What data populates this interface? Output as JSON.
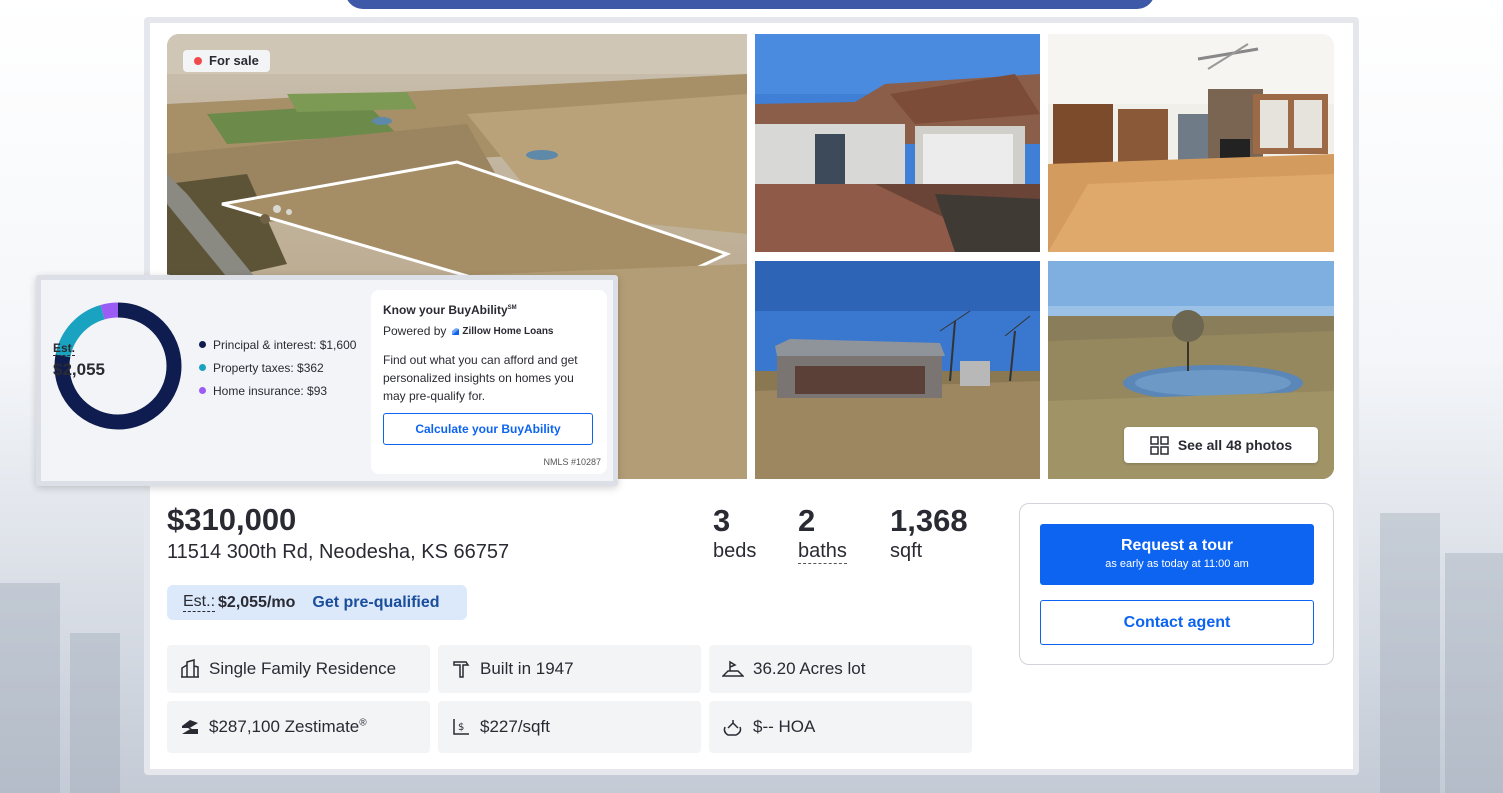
{
  "listing": {
    "status_badge": "For sale",
    "see_all_photos": "See all 48 photos",
    "price": "$310,000",
    "address": "11514 300th Rd, Neodesha, KS 66757",
    "beds_num": "3",
    "beds_label": "beds",
    "baths_num": "2",
    "baths_label": "baths",
    "sqft_num": "1,368",
    "sqft_label": "sqft"
  },
  "estimate_pill": {
    "est_label": "Est.:",
    "amount": "$2,055/mo",
    "prequal_link": "Get pre-qualified"
  },
  "payment": {
    "donut_label": "Est.",
    "donut_value": "$2,055",
    "breakdown": [
      {
        "label": "Principal & interest: $1,600",
        "value": 1600,
        "color": "#0e1c4f"
      },
      {
        "label": "Property taxes: $362",
        "value": 362,
        "color": "#1aa3c0"
      },
      {
        "label": "Home insurance: $93",
        "value": 93,
        "color": "#9b5cf6"
      }
    ]
  },
  "buyability": {
    "title": "Know your BuyAbility",
    "title_mark": "SM",
    "powered_by": "Powered by",
    "partner": "Zillow Home Loans",
    "description": "Find out what you can afford and get personalized insights on homes you may pre-qualify for.",
    "button": "Calculate your BuyAbility",
    "nmls": "NMLS #10287"
  },
  "facts": [
    {
      "text": "Single Family Residence",
      "icon": "building-icon"
    },
    {
      "text": "Built in 1947",
      "icon": "hammer-icon"
    },
    {
      "text": "36.20 Acres lot",
      "icon": "lot-icon"
    },
    {
      "text": "$287,100 Zestimate",
      "icon": "zestimate-icon",
      "mark": "®"
    },
    {
      "text": "$227/sqft",
      "icon": "price-sqft-icon"
    },
    {
      "text": "$-- HOA",
      "icon": "hoa-icon"
    }
  ],
  "cta": {
    "tour_title": "Request a tour",
    "tour_sub": "as early as today at 11:00 am",
    "contact": "Contact agent"
  },
  "colors": {
    "primary": "#0d64f0",
    "badge_dot": "#f04a4a",
    "pill_bg": "#dbe9fb"
  }
}
